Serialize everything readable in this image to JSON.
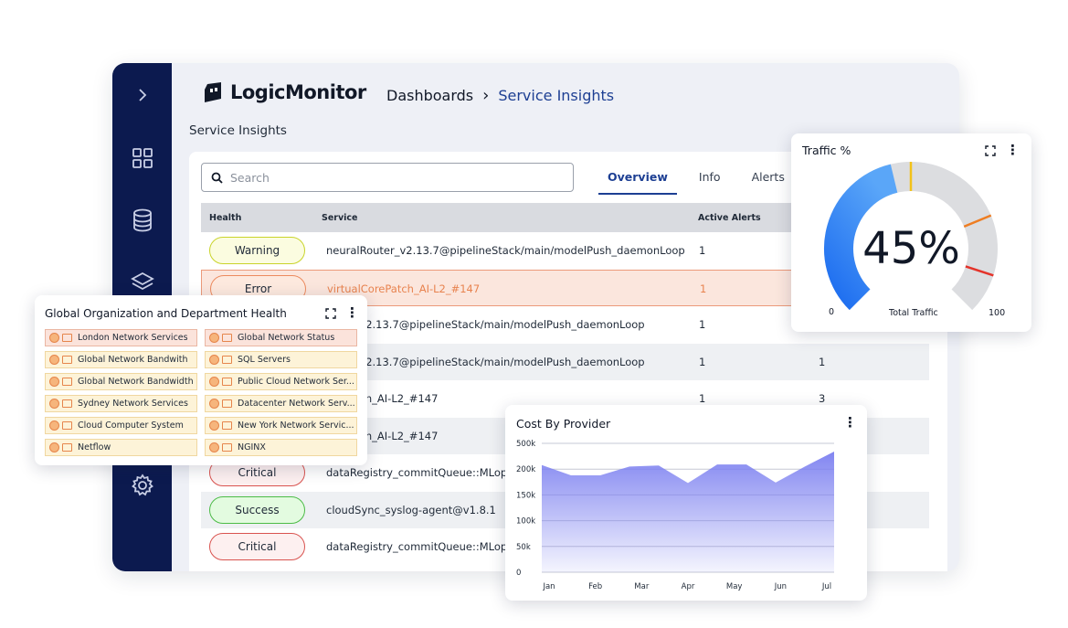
{
  "brand": {
    "name": "LogicMonitor"
  },
  "breadcrumb": {
    "first": "Dashboards",
    "separator": "›",
    "current": "Service Insights"
  },
  "page": {
    "title": "Service Insights"
  },
  "sidebar": {
    "icons": [
      "chevron-right-icon",
      "dashboard-grid-icon",
      "database-icon",
      "layers-icon",
      "settings-gear-icon"
    ]
  },
  "search": {
    "placeholder": "Search",
    "value": ""
  },
  "tabs": [
    {
      "label": "Overview",
      "active": true
    },
    {
      "label": "Info"
    },
    {
      "label": "Alerts"
    }
  ],
  "table": {
    "columns": {
      "health": "Health",
      "service": "Service",
      "alerts": "Active Alerts"
    },
    "rows": [
      {
        "health": "Warning",
        "status": "warning",
        "service": "neuralRouter_v2.13.7@pipelineStack/main/modelPush_daemonLoop",
        "alerts": "1",
        "extra": ""
      },
      {
        "health": "Error",
        "status": "error",
        "service": "virtualCorePatch_AI-L2_#147",
        "alerts": "1",
        "extra": ""
      },
      {
        "health": "",
        "status": "none",
        "service": "outer_v2.13.7@pipelineStack/main/modelPush_daemonLoop",
        "alerts": "1",
        "extra": ""
      },
      {
        "health": "",
        "status": "none",
        "service": "outer_v2.13.7@pipelineStack/main/modelPush_daemonLoop",
        "alerts": "1",
        "extra": "1"
      },
      {
        "health": "",
        "status": "none",
        "service": "orePatch_AI-L2_#147",
        "alerts": "1",
        "extra": "3"
      },
      {
        "health": "",
        "status": "none",
        "service": "orePatch_AI-L2_#147",
        "alerts": "",
        "extra": ""
      },
      {
        "health": "Critical",
        "status": "critical",
        "service": "dataRegistry_commitQueue::MLop@",
        "alerts": "",
        "extra": ""
      },
      {
        "health": "Success",
        "status": "success",
        "service": "cloudSync_syslog-agent@v1.8.1",
        "alerts": "",
        "extra": ""
      },
      {
        "health": "Critical",
        "status": "critical",
        "service": "dataRegistry_commitQueue::MLop@",
        "alerts": "",
        "extra": ""
      }
    ]
  },
  "org_health": {
    "title": "Global Organization and Department Health",
    "items": [
      {
        "label": "London Network Services",
        "tone": "pink"
      },
      {
        "label": "Global Network Status",
        "tone": "pink"
      },
      {
        "label": "Global Network Bandwith",
        "tone": "yellow"
      },
      {
        "label": "SQL Servers",
        "tone": "yellow"
      },
      {
        "label": "Global Network Bandwidth",
        "tone": "yellow"
      },
      {
        "label": "Public Cloud Network Ser...",
        "tone": "yellow"
      },
      {
        "label": "Sydney Network Services",
        "tone": "yellow"
      },
      {
        "label": "Datacenter Network Serv...",
        "tone": "yellow"
      },
      {
        "label": "Cloud Computer System",
        "tone": "yellow"
      },
      {
        "label": "New York Network Servic...",
        "tone": "yellow"
      },
      {
        "label": "Netflow",
        "tone": "yellow"
      },
      {
        "label": "NGINX",
        "tone": "yellow"
      }
    ]
  },
  "traffic": {
    "title": "Traffic %",
    "value": 45,
    "value_text": "45%",
    "min_label": "0",
    "max_label": "100",
    "caption": "Total Traffic",
    "threshold_values": [
      50,
      75,
      90
    ],
    "colors": {
      "fill": "#2f80f5",
      "track": "#dcdde0",
      "yellow": "#f2c21a",
      "orange": "#ee7d22",
      "red": "#e4332a"
    }
  },
  "chart_data": {
    "type": "area",
    "title": "Cost By Provider",
    "categories": [
      "Jan",
      "Feb",
      "Mar",
      "Apr",
      "May",
      "Jun",
      "Jul"
    ],
    "series": [
      {
        "values": [
          208000,
          188000,
          188000,
          205000,
          207000,
          173000,
          209000,
          209000,
          174000,
          205000,
          234000
        ]
      }
    ],
    "x_points": [
      "Jan",
      "",
      "Feb",
      "",
      "Mar",
      "",
      "Apr",
      "",
      "May",
      "",
      "Jun",
      "",
      "Jul"
    ],
    "yticks": [
      "0",
      "50k",
      "100k",
      "150k",
      "200k",
      "500k"
    ],
    "ylim": [
      0,
      250000
    ],
    "grid": true,
    "color": "#7b7ff0"
  }
}
